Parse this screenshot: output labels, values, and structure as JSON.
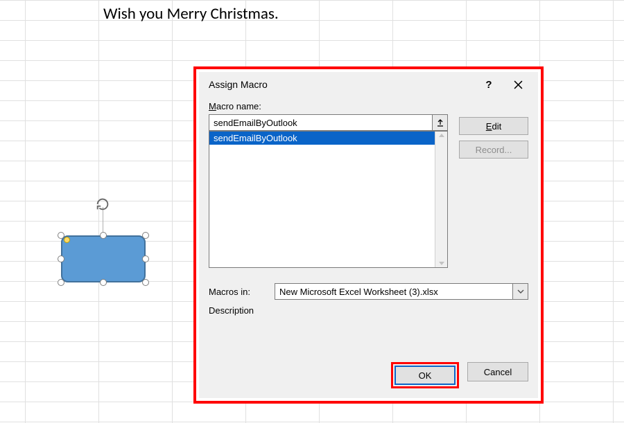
{
  "sheet": {
    "cell_text": "Wish you Merry Christmas."
  },
  "shape": {
    "name": "rounded-rectangle"
  },
  "dialog": {
    "title": "Assign Macro",
    "help_label": "?",
    "close_label": "Close",
    "macro_name_label_pre": "M",
    "macro_name_label_rest": "acro name:",
    "macro_name_value": "sendEmailByOutlook",
    "list_items": [
      "sendEmailByOutlook"
    ],
    "edit_label_pre": "E",
    "edit_label_rest": "dit",
    "record_label": "Record...",
    "macros_in_label": "Macros in:",
    "macros_in_value": "New Microsoft Excel Worksheet (3).xlsx",
    "description_label": "Description",
    "ok_label": "OK",
    "cancel_label": "Cancel"
  }
}
